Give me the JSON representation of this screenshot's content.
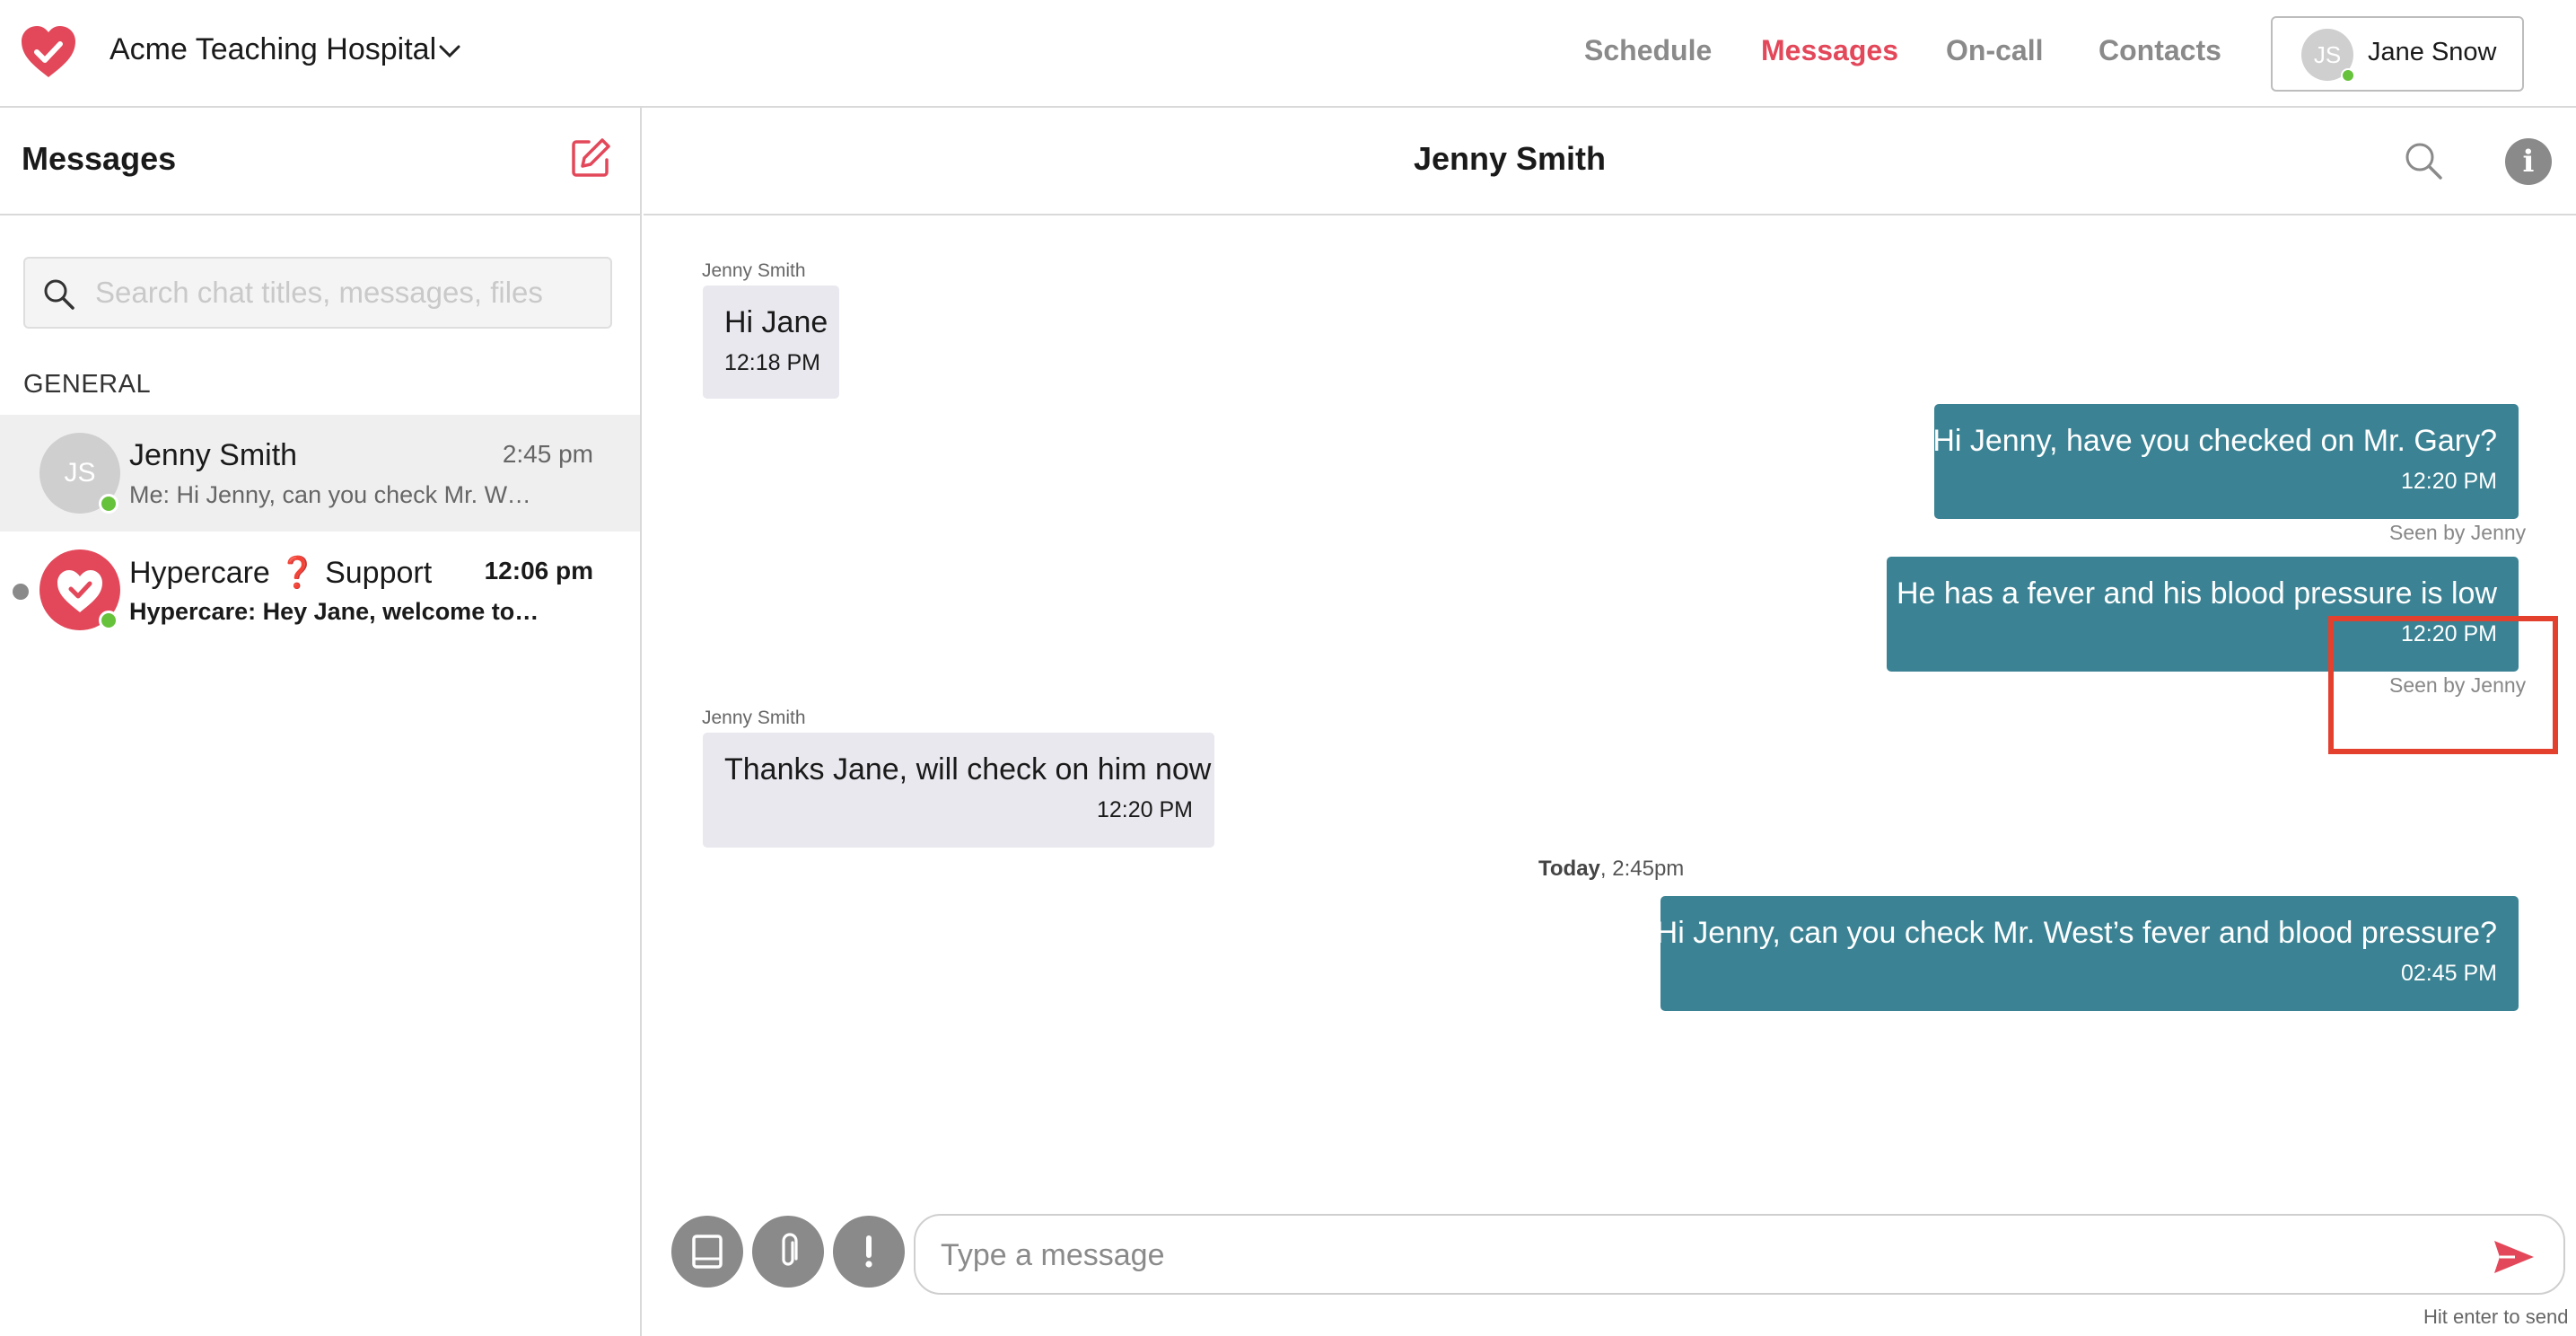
{
  "colors": {
    "brand": "#e3485a",
    "bubble_out": "#3b8394",
    "bubble_in": "#e8e8ee",
    "online": "#66c23a",
    "highlight": "#e3402e"
  },
  "topbar": {
    "org_name": "Acme Teaching Hospital",
    "nav": [
      "Schedule",
      "Messages",
      "On-call",
      "Contacts"
    ],
    "active_nav": "Messages",
    "user": {
      "initials": "JS",
      "name": "Jane Snow",
      "online": true
    }
  },
  "sidebar": {
    "title": "Messages",
    "search_placeholder": "Search chat titles, messages, files",
    "section_label": "GENERAL",
    "chats": [
      {
        "name": "Jenny Smith",
        "initials": "JS",
        "time": "2:45 pm",
        "preview": "Me: Hi Jenny, can you check Mr. West's fever and blood pressure?",
        "selected": true,
        "online": true,
        "unread": false
      },
      {
        "name_part1": "Hypercare",
        "name_icon": "❓",
        "name_part2": "Support",
        "time": "12:06 pm",
        "preview": "Hypercare: Hey Jane, welcome to Hypercare!",
        "selected": false,
        "online": true,
        "unread": true
      }
    ]
  },
  "chat": {
    "title": "Jenny Smith",
    "date_divider_bold": "Today",
    "date_divider_rest": ", 2:45pm",
    "messages": [
      {
        "direction": "in",
        "sender": "Jenny Smith",
        "text": "Hi Jane",
        "time": "12:18 PM"
      },
      {
        "direction": "out",
        "text": "Hi Jenny, have you checked on Mr. Gary?",
        "time": "12:20 PM",
        "seen": "Seen by Jenny"
      },
      {
        "direction": "out",
        "text": "He has a fever and his blood pressure is low",
        "time": "12:20 PM",
        "seen": "Seen by Jenny"
      },
      {
        "direction": "in",
        "sender": "Jenny Smith",
        "text": "Thanks Jane, will check on him now",
        "time": "12:20 PM"
      },
      {
        "direction": "out",
        "text": "Hi Jenny, can you check Mr. West’s fever and blood pressure?",
        "time": "02:45 PM"
      }
    ]
  },
  "composer": {
    "placeholder": "Type a message",
    "hint": "Hit enter to send",
    "tool_icons": [
      "template-icon",
      "paperclip-icon",
      "priority-icon"
    ]
  }
}
